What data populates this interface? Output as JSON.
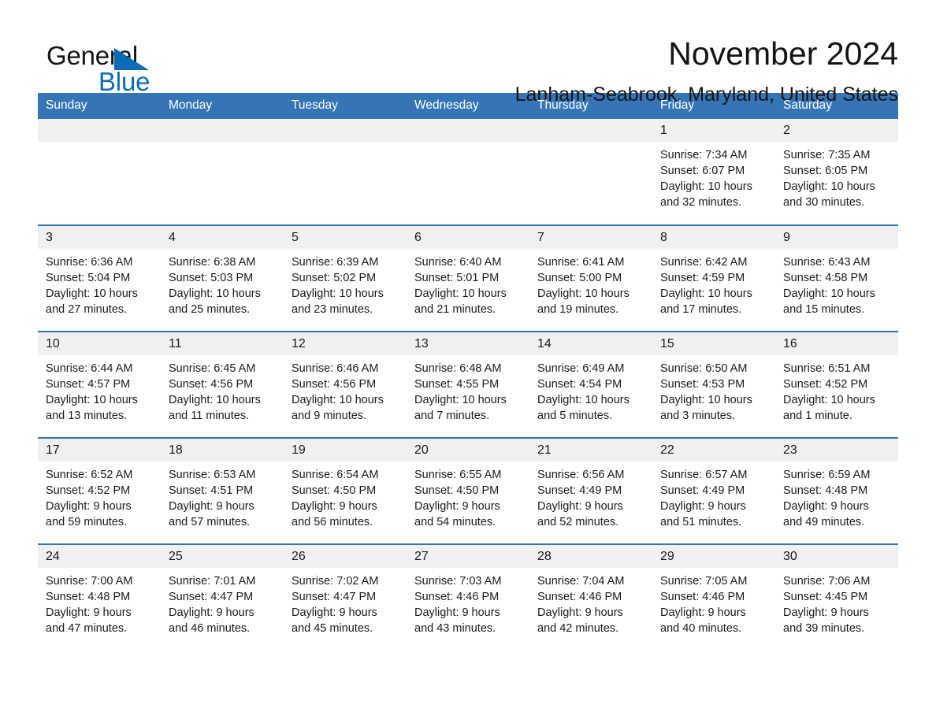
{
  "brand": {
    "name_part1": "General",
    "name_part2": "Blue",
    "triangle_color": "#0b6cb5"
  },
  "header": {
    "title": "November 2024",
    "subtitle": "Lanham-Seabrook, Maryland, United States",
    "header_bg": "#3575b5",
    "daynum_bg": "#f0f0f0"
  },
  "weekdays": [
    "Sunday",
    "Monday",
    "Tuesday",
    "Wednesday",
    "Thursday",
    "Friday",
    "Saturday"
  ],
  "labels": {
    "sunrise": "Sunrise:",
    "sunset": "Sunset:",
    "daylight": "Daylight:"
  },
  "weeks": [
    [
      {
        "day": "",
        "empty": true
      },
      {
        "day": "",
        "empty": true
      },
      {
        "day": "",
        "empty": true
      },
      {
        "day": "",
        "empty": true
      },
      {
        "day": "",
        "empty": true
      },
      {
        "day": "1",
        "sunrise": "Sunrise: 7:34 AM",
        "sunset": "Sunset: 6:07 PM",
        "daylight1": "Daylight: 10 hours",
        "daylight2": "and 32 minutes."
      },
      {
        "day": "2",
        "sunrise": "Sunrise: 7:35 AM",
        "sunset": "Sunset: 6:05 PM",
        "daylight1": "Daylight: 10 hours",
        "daylight2": "and 30 minutes."
      }
    ],
    [
      {
        "day": "3",
        "sunrise": "Sunrise: 6:36 AM",
        "sunset": "Sunset: 5:04 PM",
        "daylight1": "Daylight: 10 hours",
        "daylight2": "and 27 minutes."
      },
      {
        "day": "4",
        "sunrise": "Sunrise: 6:38 AM",
        "sunset": "Sunset: 5:03 PM",
        "daylight1": "Daylight: 10 hours",
        "daylight2": "and 25 minutes."
      },
      {
        "day": "5",
        "sunrise": "Sunrise: 6:39 AM",
        "sunset": "Sunset: 5:02 PM",
        "daylight1": "Daylight: 10 hours",
        "daylight2": "and 23 minutes."
      },
      {
        "day": "6",
        "sunrise": "Sunrise: 6:40 AM",
        "sunset": "Sunset: 5:01 PM",
        "daylight1": "Daylight: 10 hours",
        "daylight2": "and 21 minutes."
      },
      {
        "day": "7",
        "sunrise": "Sunrise: 6:41 AM",
        "sunset": "Sunset: 5:00 PM",
        "daylight1": "Daylight: 10 hours",
        "daylight2": "and 19 minutes."
      },
      {
        "day": "8",
        "sunrise": "Sunrise: 6:42 AM",
        "sunset": "Sunset: 4:59 PM",
        "daylight1": "Daylight: 10 hours",
        "daylight2": "and 17 minutes."
      },
      {
        "day": "9",
        "sunrise": "Sunrise: 6:43 AM",
        "sunset": "Sunset: 4:58 PM",
        "daylight1": "Daylight: 10 hours",
        "daylight2": "and 15 minutes."
      }
    ],
    [
      {
        "day": "10",
        "sunrise": "Sunrise: 6:44 AM",
        "sunset": "Sunset: 4:57 PM",
        "daylight1": "Daylight: 10 hours",
        "daylight2": "and 13 minutes."
      },
      {
        "day": "11",
        "sunrise": "Sunrise: 6:45 AM",
        "sunset": "Sunset: 4:56 PM",
        "daylight1": "Daylight: 10 hours",
        "daylight2": "and 11 minutes."
      },
      {
        "day": "12",
        "sunrise": "Sunrise: 6:46 AM",
        "sunset": "Sunset: 4:56 PM",
        "daylight1": "Daylight: 10 hours",
        "daylight2": "and 9 minutes."
      },
      {
        "day": "13",
        "sunrise": "Sunrise: 6:48 AM",
        "sunset": "Sunset: 4:55 PM",
        "daylight1": "Daylight: 10 hours",
        "daylight2": "and 7 minutes."
      },
      {
        "day": "14",
        "sunrise": "Sunrise: 6:49 AM",
        "sunset": "Sunset: 4:54 PM",
        "daylight1": "Daylight: 10 hours",
        "daylight2": "and 5 minutes."
      },
      {
        "day": "15",
        "sunrise": "Sunrise: 6:50 AM",
        "sunset": "Sunset: 4:53 PM",
        "daylight1": "Daylight: 10 hours",
        "daylight2": "and 3 minutes."
      },
      {
        "day": "16",
        "sunrise": "Sunrise: 6:51 AM",
        "sunset": "Sunset: 4:52 PM",
        "daylight1": "Daylight: 10 hours",
        "daylight2": "and 1 minute."
      }
    ],
    [
      {
        "day": "17",
        "sunrise": "Sunrise: 6:52 AM",
        "sunset": "Sunset: 4:52 PM",
        "daylight1": "Daylight: 9 hours",
        "daylight2": "and 59 minutes."
      },
      {
        "day": "18",
        "sunrise": "Sunrise: 6:53 AM",
        "sunset": "Sunset: 4:51 PM",
        "daylight1": "Daylight: 9 hours",
        "daylight2": "and 57 minutes."
      },
      {
        "day": "19",
        "sunrise": "Sunrise: 6:54 AM",
        "sunset": "Sunset: 4:50 PM",
        "daylight1": "Daylight: 9 hours",
        "daylight2": "and 56 minutes."
      },
      {
        "day": "20",
        "sunrise": "Sunrise: 6:55 AM",
        "sunset": "Sunset: 4:50 PM",
        "daylight1": "Daylight: 9 hours",
        "daylight2": "and 54 minutes."
      },
      {
        "day": "21",
        "sunrise": "Sunrise: 6:56 AM",
        "sunset": "Sunset: 4:49 PM",
        "daylight1": "Daylight: 9 hours",
        "daylight2": "and 52 minutes."
      },
      {
        "day": "22",
        "sunrise": "Sunrise: 6:57 AM",
        "sunset": "Sunset: 4:49 PM",
        "daylight1": "Daylight: 9 hours",
        "daylight2": "and 51 minutes."
      },
      {
        "day": "23",
        "sunrise": "Sunrise: 6:59 AM",
        "sunset": "Sunset: 4:48 PM",
        "daylight1": "Daylight: 9 hours",
        "daylight2": "and 49 minutes."
      }
    ],
    [
      {
        "day": "24",
        "sunrise": "Sunrise: 7:00 AM",
        "sunset": "Sunset: 4:48 PM",
        "daylight1": "Daylight: 9 hours",
        "daylight2": "and 47 minutes."
      },
      {
        "day": "25",
        "sunrise": "Sunrise: 7:01 AM",
        "sunset": "Sunset: 4:47 PM",
        "daylight1": "Daylight: 9 hours",
        "daylight2": "and 46 minutes."
      },
      {
        "day": "26",
        "sunrise": "Sunrise: 7:02 AM",
        "sunset": "Sunset: 4:47 PM",
        "daylight1": "Daylight: 9 hours",
        "daylight2": "and 45 minutes."
      },
      {
        "day": "27",
        "sunrise": "Sunrise: 7:03 AM",
        "sunset": "Sunset: 4:46 PM",
        "daylight1": "Daylight: 9 hours",
        "daylight2": "and 43 minutes."
      },
      {
        "day": "28",
        "sunrise": "Sunrise: 7:04 AM",
        "sunset": "Sunset: 4:46 PM",
        "daylight1": "Daylight: 9 hours",
        "daylight2": "and 42 minutes."
      },
      {
        "day": "29",
        "sunrise": "Sunrise: 7:05 AM",
        "sunset": "Sunset: 4:46 PM",
        "daylight1": "Daylight: 9 hours",
        "daylight2": "and 40 minutes."
      },
      {
        "day": "30",
        "sunrise": "Sunrise: 7:06 AM",
        "sunset": "Sunset: 4:45 PM",
        "daylight1": "Daylight: 9 hours",
        "daylight2": "and 39 minutes."
      }
    ]
  ]
}
